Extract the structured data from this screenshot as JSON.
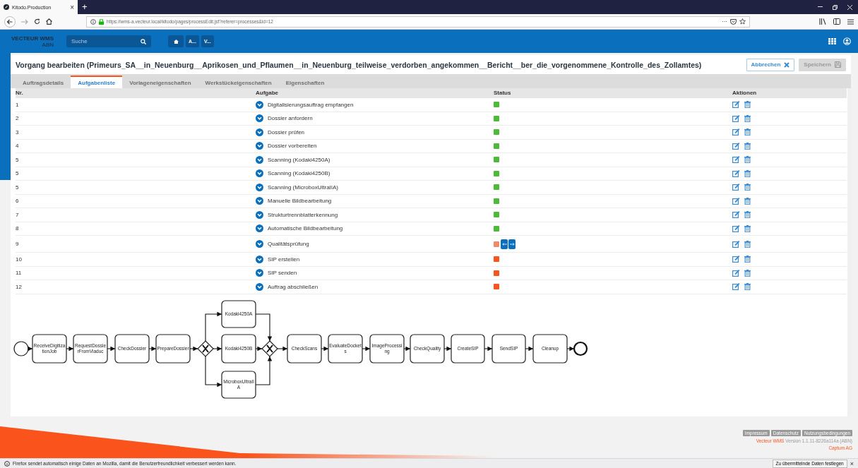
{
  "browser": {
    "tab_title": "Kitodo.Production",
    "tab_close": "×",
    "new_tab": "+",
    "url": "https://wms-a.vecteur.local/kitodo/pages/processEdit.jsf?referer=processes&id=12",
    "page_actions": "···"
  },
  "header": {
    "logo_line1": "VECTEUR WMS",
    "logo_line2": "ABN",
    "search_placeholder": "Suche",
    "breadcrumbs": [
      "A...",
      "V..."
    ]
  },
  "title": "Vorgang bearbeiten (Primeurs_SA__in_Neuenburg__Aprikosen_und_Pflaumen__in_Neuenburg_teilweise_verdorben_angekommen__Bericht__ber_die_vorgenommene_Kontrolle_des_Zollamtes)",
  "buttons": [
    {
      "label": "Abbrechen",
      "disabled": false
    },
    {
      "label": "Speichern",
      "disabled": true
    }
  ],
  "tabs": [
    {
      "label": "Auftragsdetails",
      "selected": false
    },
    {
      "label": "Aufgabenliste",
      "selected": true
    },
    {
      "label": "Vorlageneigenschaften",
      "selected": false
    },
    {
      "label": "Werkstückeigenschaften",
      "selected": false
    },
    {
      "label": "Eigenschaften",
      "selected": false
    }
  ],
  "table": {
    "columns": [
      "Nr.",
      "Aufgabe",
      "Status",
      "Aktionen"
    ],
    "rows": [
      {
        "nr": "1",
        "task": "Digitalisierungsauftrag empfangen",
        "color": "#4cbb3a",
        "kind": "plain"
      },
      {
        "nr": "2",
        "task": "Dossier anfordern",
        "color": "#4cbb3a",
        "kind": "plain"
      },
      {
        "nr": "3",
        "task": "Dossier prüfen",
        "color": "#4cbb3a",
        "kind": "plain"
      },
      {
        "nr": "4",
        "task": "Dossier vorbereiten",
        "color": "#4cbb3a",
        "kind": "plain"
      },
      {
        "nr": "5",
        "task": "Scanning (Kodaki4250A)",
        "color": "#4cbb3a",
        "kind": "plain"
      },
      {
        "nr": "5",
        "task": "Scanning (Kodaki4250B)",
        "color": "#4cbb3a",
        "kind": "plain"
      },
      {
        "nr": "5",
        "task": "Scanning (MicroboxUltraIIA)",
        "color": "#4cbb3a",
        "kind": "plain"
      },
      {
        "nr": "6",
        "task": "Manuelle Bildbearbeitung",
        "color": "#4cbb3a",
        "kind": "plain"
      },
      {
        "nr": "7",
        "task": "Strukturtrennblatterkennung",
        "color": "#4cbb3a",
        "kind": "plain"
      },
      {
        "nr": "8",
        "task": "Automatische Bildbearbeitung",
        "color": "#4cbb3a",
        "kind": "plain"
      },
      {
        "nr": "9",
        "task": "Qualitätsprüfung",
        "color": "#f08a6c",
        "kind": "movable"
      },
      {
        "nr": "10",
        "task": "SIP erstellen",
        "color": "#fa541c",
        "kind": "plain"
      },
      {
        "nr": "11",
        "task": "SIP senden",
        "color": "#fa541c",
        "kind": "plain"
      },
      {
        "nr": "12",
        "task": "Auftrag abschließen",
        "color": "#fa541c",
        "kind": "plain"
      }
    ]
  },
  "workflow_diagram": {
    "tasks": [
      [
        "ReceiveDigitiza",
        "tionJob"
      ],
      [
        "RequestDossie",
        "rFromViaduc"
      ],
      [
        "CheckDossier"
      ],
      [
        "PrepareDossier"
      ],
      [
        "Kodaki4250A"
      ],
      [
        "Kodaki4250B"
      ],
      [
        "MicroboxUltraII",
        "A"
      ],
      [
        "CheckScans"
      ],
      [
        "EvaluateDocket",
        "s"
      ],
      [
        "ImageProcessi",
        "ng"
      ],
      [
        "CheckQuality"
      ],
      [
        "CreateSIP"
      ],
      [
        "SendSIP"
      ],
      [
        "Cleanup"
      ]
    ]
  },
  "footer": {
    "links": [
      "Impressum",
      "Datenschutz",
      "Nutzungsbedingungen"
    ],
    "brand": "Vecteur WMS",
    "version": "Version 1.1.11-8226a114a (ABN)",
    "company": "Captum AG"
  },
  "notification": {
    "text": "Firefox sendet automatisch einige Daten an Mozilla, damit die Benutzerfreundlichkeit verbessert werden kann.",
    "button": "Zu übermittelnde Daten festlegen",
    "close": "×"
  }
}
